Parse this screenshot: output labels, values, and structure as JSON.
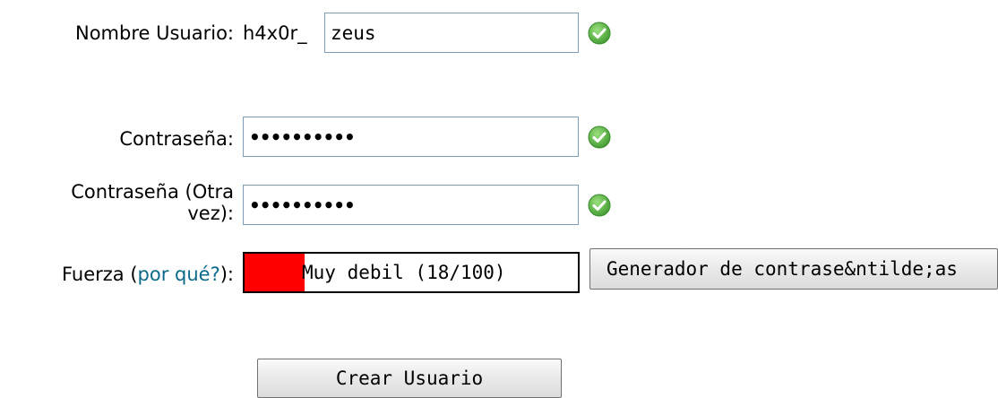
{
  "username": {
    "label": "Nombre Usuario:",
    "prefix": "h4x0r_",
    "value": "zeus"
  },
  "password": {
    "label": "Contraseña:",
    "value": "••••••••••"
  },
  "password_confirm": {
    "label_line1": "Contraseña (Otra",
    "label_line2": "vez):",
    "value": "••••••••••"
  },
  "strength": {
    "label_prefix": "Fuerza (",
    "link": "por qué?",
    "label_suffix": "):",
    "text": "Muy debil (18/100)",
    "score": 18,
    "max": 100,
    "fill_color": "#ff0000"
  },
  "buttons": {
    "generator": "Generador de contrase&ntilde;as",
    "create": "Crear Usuario"
  },
  "icons": {
    "valid": "check-circle-icon",
    "valid_color": "#4cae3c"
  }
}
